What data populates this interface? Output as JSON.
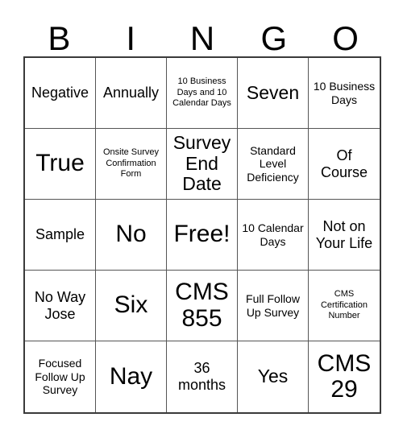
{
  "card": {
    "headers": [
      "B",
      "I",
      "N",
      "G",
      "O"
    ],
    "rows": [
      [
        {
          "text": "Negative",
          "size": "md"
        },
        {
          "text": "Annually",
          "size": "md"
        },
        {
          "text": "10 Business Days and 10 Calendar Days",
          "size": "xs"
        },
        {
          "text": "Seven",
          "size": "lg"
        },
        {
          "text": "10 Business Days",
          "size": "sm"
        }
      ],
      [
        {
          "text": "True",
          "size": "xl"
        },
        {
          "text": "Onsite Survey Confirmation Form",
          "size": "xs"
        },
        {
          "text": "Survey End Date",
          "size": "lg"
        },
        {
          "text": "Standard Level Deficiency",
          "size": "sm"
        },
        {
          "text": "Of Course",
          "size": "md"
        }
      ],
      [
        {
          "text": "Sample",
          "size": "md"
        },
        {
          "text": "No",
          "size": "xl"
        },
        {
          "text": "Free!",
          "size": "xl"
        },
        {
          "text": "10 Calendar Days",
          "size": "sm"
        },
        {
          "text": "Not on Your Life",
          "size": "md"
        }
      ],
      [
        {
          "text": "No Way Jose",
          "size": "md"
        },
        {
          "text": "Six",
          "size": "xl"
        },
        {
          "text": "CMS 855",
          "size": "xl"
        },
        {
          "text": "Full Follow Up Survey",
          "size": "sm"
        },
        {
          "text": "CMS Certification Number",
          "size": "xs"
        }
      ],
      [
        {
          "text": "Focused Follow Up Survey",
          "size": "sm"
        },
        {
          "text": "Nay",
          "size": "xl"
        },
        {
          "text": "36 months",
          "size": "md"
        },
        {
          "text": "Yes",
          "size": "lg"
        },
        {
          "text": "CMS 29",
          "size": "xl"
        }
      ]
    ],
    "free_space_text": "Free!",
    "colors": {
      "background": "#ffffff",
      "text": "#000000",
      "inner_border": "#555555",
      "outer_border": "#3a3a3a"
    }
  }
}
